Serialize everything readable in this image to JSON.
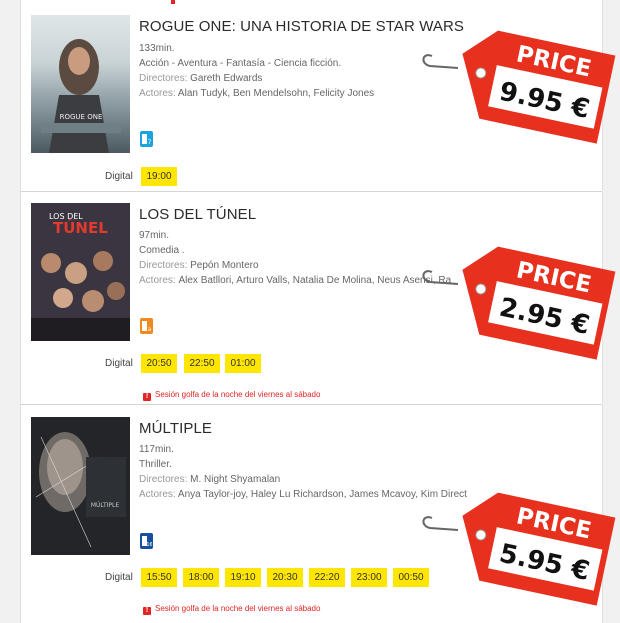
{
  "movies": [
    {
      "title": "ROGUE ONE: UNA HISTORIA DE STAR WARS",
      "duration": "133min.",
      "genres": "Acción - Aventura - Fantasía - Ciencia ficción.",
      "directors_label": "Directores:",
      "directors": "Gareth Edwards",
      "actors_label": "Actores:",
      "actors": "Alan Tudyk, Ben Mendelsohn, Felicity Jones",
      "rating_badge": "7",
      "format": "Digital",
      "showtimes": [
        "19:00"
      ],
      "price_label": "PRICE",
      "price": "9.95 €"
    },
    {
      "title": "LOS DEL TÚNEL",
      "duration": "97min.",
      "genres": "Comedia .",
      "directors_label": "Directores:",
      "directors": "Pepón Montero",
      "actors_label": "Actores:",
      "actors": "Àlex Batllori, Arturo Valls, Natalia De Molina, Neus Asensi, Ra",
      "rating_badge": "a",
      "format": "Digital",
      "showtimes": [
        "20:50",
        "22:50",
        "01:00"
      ],
      "note": "Sesión golfa de la noche del viernes al sábado",
      "price_label": "PRICE",
      "price": "2.95 €"
    },
    {
      "title": "MÚLTIPLE",
      "duration": "117min.",
      "genres": "Thriller.",
      "directors_label": "Directores:",
      "directors": "M. Night Shyamalan",
      "actors_label": "Actores:",
      "actors": "Anya Taylor-joy, Haley Lu Richardson, James Mcavoy, Kim Direct",
      "rating_badge": "16",
      "format": "Digital",
      "showtimes": [
        "15:50",
        "18:00",
        "19:10",
        "20:30",
        "22:20",
        "23:00",
        "00:50"
      ],
      "note": "Sesión golfa de la noche del viernes al sábado",
      "price_label": "PRICE",
      "price": "5.95 €"
    }
  ],
  "poster_texts": {
    "rogue": "ROGUE ONE",
    "tunel_a": "LOS DEL",
    "tunel_b": "TÚNEL",
    "multiple": "MÚLTIPLE"
  },
  "colors": {
    "chip": "#ffe600",
    "tag": "#e8301e",
    "warn": "#e32424",
    "badge_blue": "#19a3e0",
    "badge_orange": "#f08a1c",
    "badge_navy": "#1a4fa0"
  },
  "icons": {
    "warning": "exclamation-icon",
    "rating": "age-rating-icon"
  }
}
